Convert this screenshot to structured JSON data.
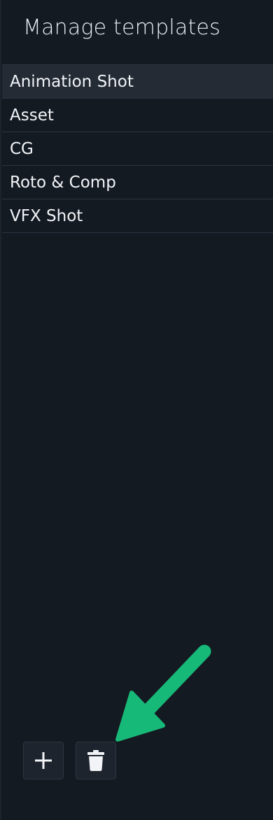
{
  "panel": {
    "title": "Manage templates"
  },
  "templates": {
    "items": [
      {
        "label": "Animation Shot"
      },
      {
        "label": "Asset"
      },
      {
        "label": "CG"
      },
      {
        "label": "Roto & Comp"
      },
      {
        "label": "VFX Shot"
      }
    ],
    "selected_index": 0
  },
  "actions": {
    "add_icon": "plus-icon",
    "delete_icon": "trash-icon"
  },
  "annotation": {
    "color": "#17b978",
    "target": "delete-template-button"
  },
  "colors": {
    "background": "#141a22",
    "selected_row": "#242b35",
    "divider": "#2b3440",
    "text": "#f2f4f7"
  }
}
